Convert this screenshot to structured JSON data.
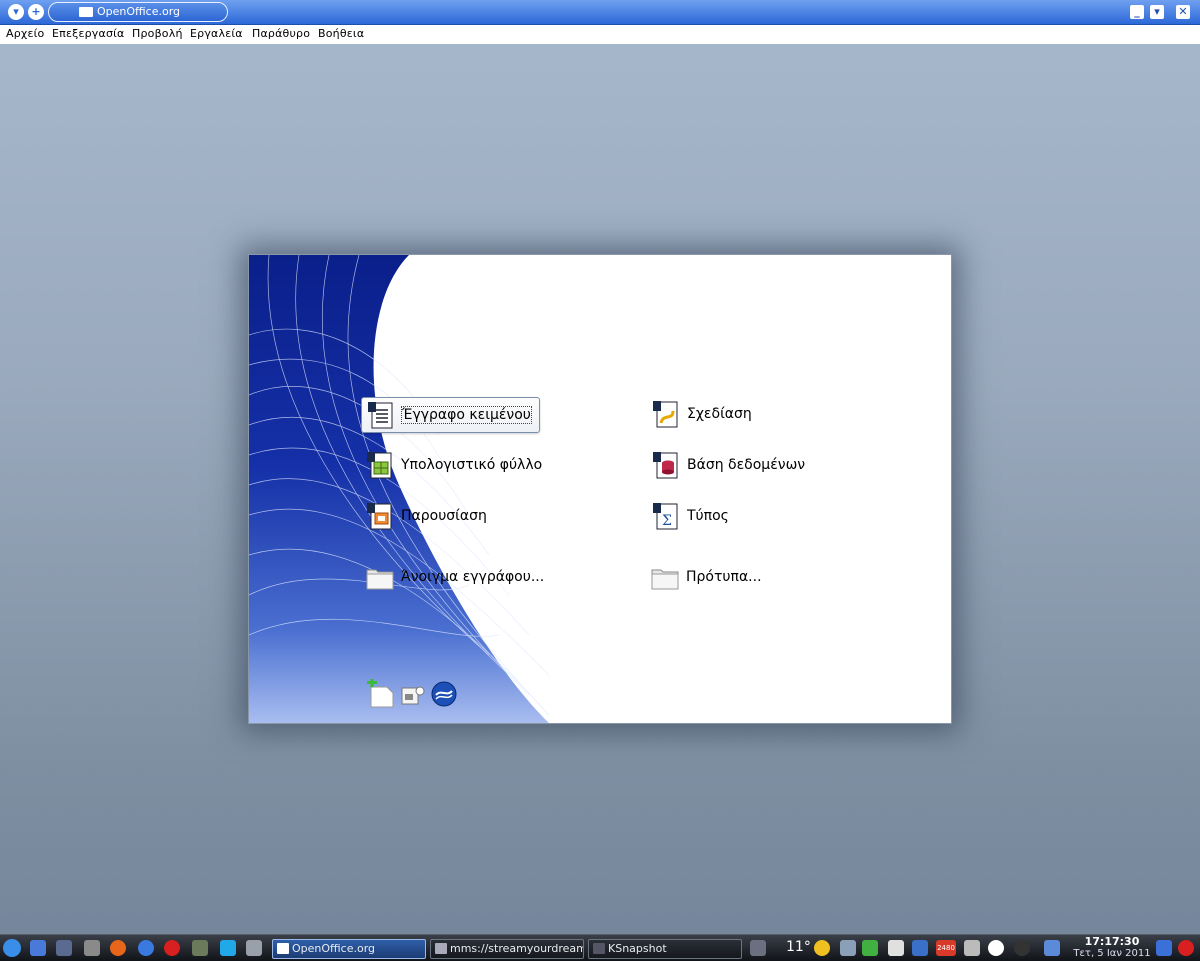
{
  "window": {
    "title": "OpenOffice.org",
    "buttons": [
      "minimize-icon",
      "maximize-icon",
      "close-icon"
    ]
  },
  "menubar": {
    "items": [
      "Αρχείο",
      "Επεξεργασία",
      "Προβολή",
      "Εργαλεία",
      "Παράθυρο",
      "Βοήθεια"
    ]
  },
  "start_center": {
    "items": {
      "writer": {
        "label": "Έγγραφο κειμένου",
        "icon": "writer-document-icon"
      },
      "draw": {
        "label": "Σχεδίαση",
        "icon": "draw-document-icon"
      },
      "calc": {
        "label": "Υπολογιστικό φύλλο",
        "icon": "calc-document-icon"
      },
      "base": {
        "label": "Βάση δεδομένων",
        "icon": "base-database-icon"
      },
      "impress": {
        "label": "Παρουσίαση",
        "icon": "impress-presentation-icon"
      },
      "math": {
        "label": "Τύπος",
        "icon": "math-formula-icon"
      },
      "open": {
        "label": "Άνοιγμα εγγράφου...",
        "icon": "folder-icon"
      },
      "templates": {
        "label": "Πρότυπα...",
        "icon": "folder-icon"
      }
    },
    "bottom_icons": [
      "new-extension-icon",
      "info-icon",
      "openoffice-logo-icon"
    ]
  },
  "taskbar": {
    "tasks": [
      {
        "label": "OpenOffice.org",
        "active": true
      },
      {
        "label": "mms://streamyourdream",
        "active": false
      },
      {
        "label": "KSnapshot",
        "active": false
      }
    ],
    "weather": "11°",
    "badge": "2480",
    "clock": {
      "time": "17:17:30",
      "date": "Τετ, 5 Ιαν 2011"
    }
  },
  "colors": {
    "titlebar": "#2c68d8",
    "swoosh_blue": "#0a1f8a",
    "taskbar": "#111418"
  }
}
